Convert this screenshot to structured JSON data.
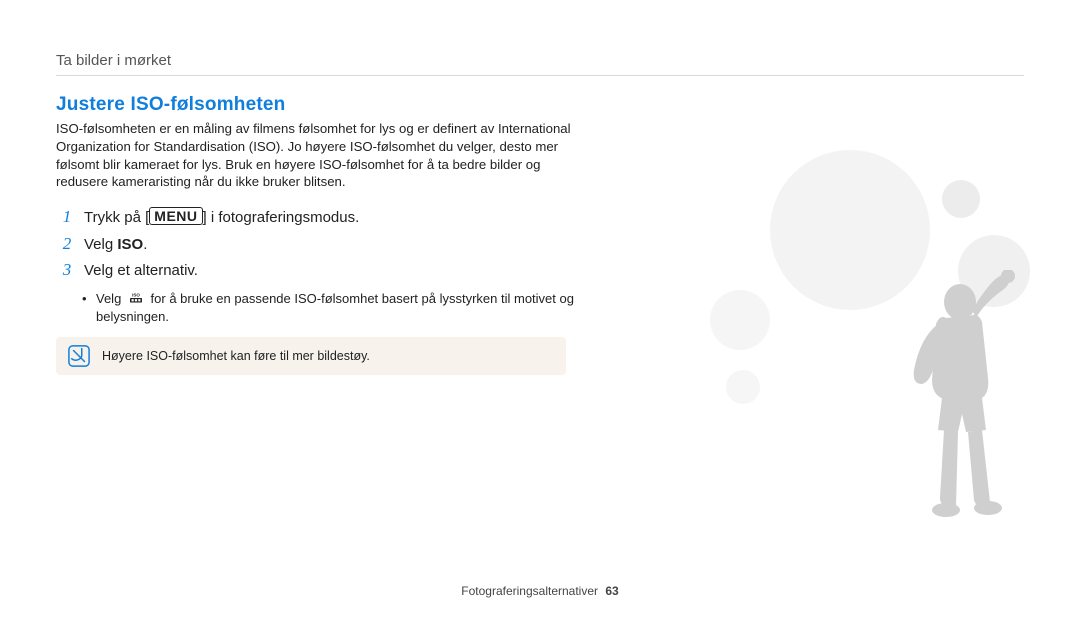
{
  "breadcrumb": "Ta bilder i mørket",
  "heading": "Justere ISO-følsomheten",
  "intro": "ISO-følsomheten er en måling av filmens følsomhet for lys og er definert av International Organization for Standardisation (ISO). Jo høyere ISO-følsomhet du velger, desto mer følsomt blir kameraet for lys. Bruk en høyere ISO-følsomhet for å ta bedre bilder og redusere kameraristing når du ikke bruker blitsen.",
  "steps": {
    "s1_pre": "Trykk på [",
    "s1_menu": "MENU",
    "s1_post": "] i fotograferingsmodus.",
    "s2_pre": "Velg ",
    "s2_bold": "ISO",
    "s2_post": ".",
    "s3": "Velg et alternativ."
  },
  "sub_bullet": {
    "pre": "Velg ",
    "post": " for å bruke en passende ISO-følsomhet basert på lysstyrken til motivet og belysningen."
  },
  "note": "Høyere ISO-følsomhet kan føre til mer bildestøy.",
  "footer_section": "Fotograferingsalternativer",
  "footer_page": "63"
}
